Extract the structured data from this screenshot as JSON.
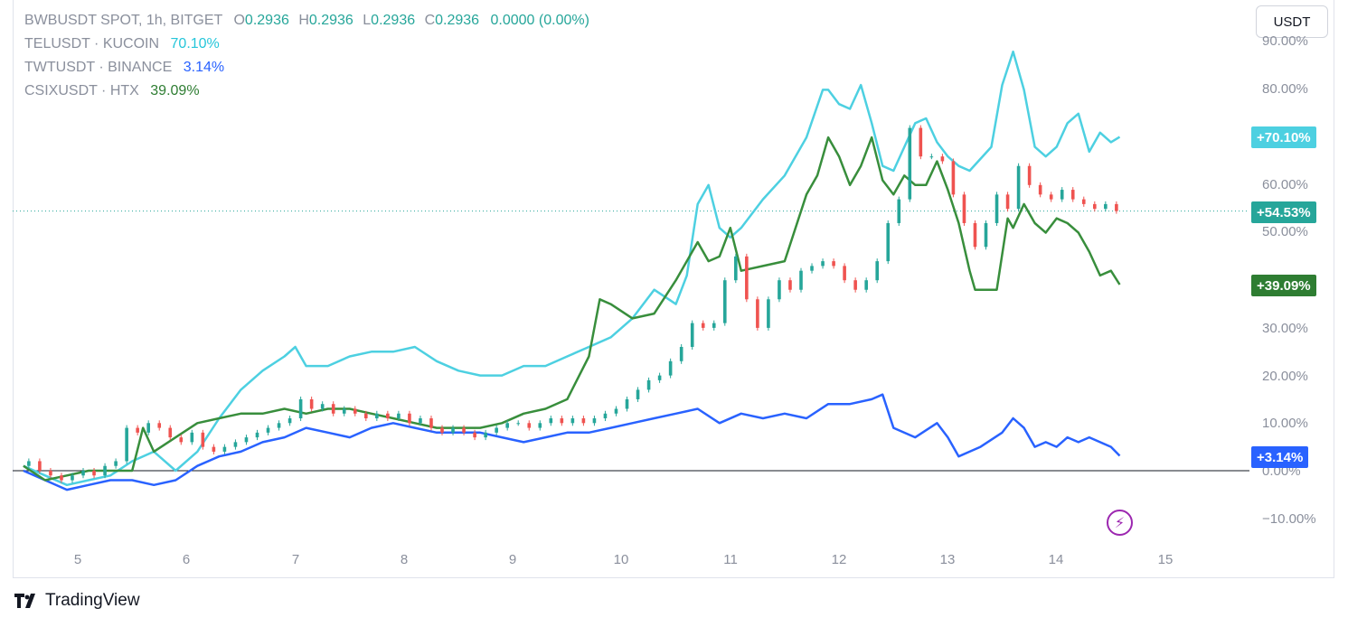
{
  "legend": {
    "main": {
      "symbol": "BWBUSDT SPOT, 1h, BITGET",
      "o_label": "O",
      "o_value": "0.2936",
      "h_label": "H",
      "h_value": "0.2936",
      "l_label": "L",
      "l_value": "0.2936",
      "c_label": "C",
      "c_value": "0.2936",
      "change": "0.0000 (0.00%)"
    },
    "compare": [
      {
        "symbol": "TELUSDT · KUCOIN",
        "value": "70.10%"
      },
      {
        "symbol": "TWTUSDT · BINANCE",
        "value": "3.14%"
      },
      {
        "symbol": "CSIXUSDT · HTX",
        "value": "39.09%"
      }
    ]
  },
  "unit_button": "USDT",
  "colors": {
    "tel": "#4dd0e1",
    "twt": "#2962ff",
    "csix": "#388e3c",
    "up": "#26a69a",
    "down": "#ef5350",
    "badge_main": "#26a69a",
    "badge_tel": "#4dd0e1",
    "badge_csix": "#2e7d32",
    "badge_twt": "#2962ff"
  },
  "badges": {
    "tel": "+70.10%",
    "main": "+54.53%",
    "csix": "+39.09%",
    "twt": "+3.14%"
  },
  "brand": "TradingView",
  "icons": {
    "alert": "lightning-icon",
    "logo": "tradingview-logo-icon"
  },
  "chart_data": {
    "type": "line",
    "ylabel_unit": "%",
    "ylim": [
      -15,
      95
    ],
    "y_ticks": [
      "90.00%",
      "80.00%",
      "60.00%",
      "50.00%",
      "30.00%",
      "20.00%",
      "10.00%",
      "0.00%",
      "−10.00%"
    ],
    "x_ticks": [
      "5",
      "6",
      "7",
      "8",
      "9",
      "10",
      "11",
      "12",
      "13",
      "14",
      "15"
    ],
    "series": [
      {
        "name": "TELUSDT · KUCOIN",
        "key": "tel",
        "x": [
          4.5,
          4.7,
          4.9,
          5.1,
          5.3,
          5.5,
          5.7,
          5.9,
          6.1,
          6.3,
          6.5,
          6.7,
          6.9,
          7.0,
          7.1,
          7.3,
          7.5,
          7.7,
          7.9,
          8.1,
          8.3,
          8.5,
          8.7,
          8.9,
          9.1,
          9.3,
          9.5,
          9.7,
          9.9,
          10.1,
          10.3,
          10.5,
          10.6,
          10.7,
          10.8,
          10.9,
          11.0,
          11.1,
          11.3,
          11.5,
          11.7,
          11.85,
          11.9,
          12.0,
          12.1,
          12.2,
          12.3,
          12.4,
          12.5,
          12.6,
          12.7,
          12.8,
          12.9,
          13.0,
          13.1,
          13.2,
          13.4,
          13.5,
          13.6,
          13.7,
          13.8,
          13.9,
          14.0,
          14.1,
          14.2,
          14.3,
          14.4,
          14.5,
          14.58
        ],
        "y": [
          1,
          -1,
          -3,
          -2,
          -1,
          2,
          4,
          0,
          4,
          11,
          17,
          21,
          24,
          26,
          22,
          22,
          24,
          25,
          25,
          26,
          23,
          21,
          20,
          20,
          22,
          22,
          24,
          26,
          28,
          32,
          38,
          35,
          41,
          56,
          60,
          51,
          49,
          51,
          57,
          62,
          70,
          80,
          80,
          77,
          76,
          81,
          73,
          64,
          63,
          68,
          73,
          74,
          69,
          66,
          64,
          63,
          68,
          81,
          88,
          80,
          68,
          66,
          68,
          73,
          75,
          67,
          71,
          69,
          70.1
        ]
      },
      {
        "name": "TWTUSDT · BINANCE",
        "key": "twt",
        "x": [
          4.5,
          4.7,
          4.9,
          5.1,
          5.3,
          5.5,
          5.7,
          5.9,
          6.1,
          6.3,
          6.5,
          6.7,
          6.9,
          7.1,
          7.3,
          7.5,
          7.7,
          7.9,
          8.1,
          8.3,
          8.5,
          8.7,
          8.9,
          9.1,
          9.3,
          9.5,
          9.7,
          9.9,
          10.1,
          10.3,
          10.5,
          10.7,
          10.9,
          11.1,
          11.3,
          11.5,
          11.7,
          11.9,
          12.1,
          12.3,
          12.4,
          12.5,
          12.7,
          12.9,
          13.0,
          13.1,
          13.2,
          13.3,
          13.5,
          13.6,
          13.7,
          13.8,
          13.9,
          14.0,
          14.1,
          14.2,
          14.3,
          14.4,
          14.5,
          14.58
        ],
        "y": [
          0,
          -2,
          -4,
          -3,
          -2,
          -2,
          -3,
          -2,
          1,
          3,
          4,
          6,
          7,
          9,
          8,
          7,
          9,
          10,
          9,
          8,
          8,
          8,
          7,
          6,
          7,
          8,
          8,
          9,
          10,
          11,
          12,
          13,
          10,
          12,
          11,
          12,
          11,
          14,
          14,
          15,
          16,
          9,
          7,
          10,
          7,
          3,
          4,
          5,
          8,
          11,
          9,
          5,
          6,
          5,
          7,
          6,
          7,
          6,
          5,
          3.14
        ]
      },
      {
        "name": "CSIXUSDT · HTX",
        "key": "csix",
        "x": [
          4.5,
          4.7,
          4.9,
          5.1,
          5.3,
          5.5,
          5.6,
          5.7,
          5.9,
          6.1,
          6.3,
          6.5,
          6.7,
          6.9,
          7.1,
          7.3,
          7.5,
          7.7,
          7.9,
          8.1,
          8.3,
          8.5,
          8.7,
          8.9,
          9.1,
          9.3,
          9.5,
          9.7,
          9.8,
          9.9,
          10.1,
          10.3,
          10.5,
          10.7,
          10.8,
          10.9,
          11.0,
          11.1,
          11.3,
          11.5,
          11.7,
          11.8,
          11.9,
          12.0,
          12.1,
          12.2,
          12.3,
          12.4,
          12.5,
          12.6,
          12.7,
          12.8,
          12.9,
          13.0,
          13.1,
          13.2,
          13.25,
          13.3,
          13.45,
          13.55,
          13.6,
          13.7,
          13.8,
          13.9,
          14.0,
          14.1,
          14.2,
          14.3,
          14.4,
          14.5,
          14.58
        ],
        "y": [
          1,
          -2,
          -1,
          0,
          0,
          0,
          9,
          4,
          7,
          10,
          11,
          12,
          12,
          13,
          12,
          13,
          13,
          12,
          11,
          10,
          9,
          9,
          9,
          10,
          12,
          13,
          15,
          24,
          36,
          35,
          32,
          33,
          40,
          48,
          44,
          45,
          51,
          42,
          43,
          44,
          58,
          62,
          70,
          66,
          60,
          64,
          70,
          61,
          58,
          62,
          60,
          60,
          65,
          59,
          52,
          42,
          38,
          38,
          38,
          53,
          51,
          56,
          52,
          50,
          53,
          52,
          50,
          46,
          41,
          42,
          39.09
        ]
      }
    ],
    "candles": [
      {
        "x": 4.55,
        "o": 1,
        "c": 2
      },
      {
        "x": 4.65,
        "o": 2,
        "c": 0
      },
      {
        "x": 4.75,
        "o": 0,
        "c": -1
      },
      {
        "x": 4.85,
        "o": -1,
        "c": -2
      },
      {
        "x": 4.95,
        "o": -2,
        "c": -1
      },
      {
        "x": 5.05,
        "o": -1,
        "c": 0
      },
      {
        "x": 5.15,
        "o": 0,
        "c": -1
      },
      {
        "x": 5.25,
        "o": -1,
        "c": 1
      },
      {
        "x": 5.35,
        "o": 1,
        "c": 2
      },
      {
        "x": 5.45,
        "o": 2,
        "c": 9
      },
      {
        "x": 5.55,
        "o": 9,
        "c": 8
      },
      {
        "x": 5.65,
        "o": 8,
        "c": 10
      },
      {
        "x": 5.75,
        "o": 10,
        "c": 9
      },
      {
        "x": 5.85,
        "o": 9,
        "c": 7
      },
      {
        "x": 5.95,
        "o": 7,
        "c": 6
      },
      {
        "x": 6.05,
        "o": 6,
        "c": 8
      },
      {
        "x": 6.15,
        "o": 8,
        "c": 5
      },
      {
        "x": 6.25,
        "o": 5,
        "c": 4
      },
      {
        "x": 6.35,
        "o": 4,
        "c": 5
      },
      {
        "x": 6.45,
        "o": 5,
        "c": 6
      },
      {
        "x": 6.55,
        "o": 6,
        "c": 7
      },
      {
        "x": 6.65,
        "o": 7,
        "c": 8
      },
      {
        "x": 6.75,
        "o": 8,
        "c": 9
      },
      {
        "x": 6.85,
        "o": 9,
        "c": 10
      },
      {
        "x": 6.95,
        "o": 10,
        "c": 11
      },
      {
        "x": 7.05,
        "o": 11,
        "c": 15
      },
      {
        "x": 7.15,
        "o": 15,
        "c": 13
      },
      {
        "x": 7.25,
        "o": 13,
        "c": 14
      },
      {
        "x": 7.35,
        "o": 14,
        "c": 12
      },
      {
        "x": 7.45,
        "o": 12,
        "c": 13
      },
      {
        "x": 7.55,
        "o": 13,
        "c": 12
      },
      {
        "x": 7.65,
        "o": 12,
        "c": 11
      },
      {
        "x": 7.75,
        "o": 11,
        "c": 12
      },
      {
        "x": 7.85,
        "o": 12,
        "c": 11
      },
      {
        "x": 7.95,
        "o": 11,
        "c": 12
      },
      {
        "x": 8.05,
        "o": 12,
        "c": 10
      },
      {
        "x": 8.15,
        "o": 10,
        "c": 11
      },
      {
        "x": 8.25,
        "o": 11,
        "c": 9
      },
      {
        "x": 8.35,
        "o": 9,
        "c": 8
      },
      {
        "x": 8.45,
        "o": 8,
        "c": 9
      },
      {
        "x": 8.55,
        "o": 9,
        "c": 8
      },
      {
        "x": 8.65,
        "o": 8,
        "c": 7
      },
      {
        "x": 8.75,
        "o": 7,
        "c": 8
      },
      {
        "x": 8.85,
        "o": 8,
        "c": 9
      },
      {
        "x": 8.95,
        "o": 9,
        "c": 10
      },
      {
        "x": 9.05,
        "o": 10,
        "c": 10
      },
      {
        "x": 9.15,
        "o": 10,
        "c": 9
      },
      {
        "x": 9.25,
        "o": 9,
        "c": 10
      },
      {
        "x": 9.35,
        "o": 10,
        "c": 11
      },
      {
        "x": 9.45,
        "o": 11,
        "c": 10
      },
      {
        "x": 9.55,
        "o": 10,
        "c": 11
      },
      {
        "x": 9.65,
        "o": 11,
        "c": 10
      },
      {
        "x": 9.75,
        "o": 10,
        "c": 11
      },
      {
        "x": 9.85,
        "o": 11,
        "c": 12
      },
      {
        "x": 9.95,
        "o": 12,
        "c": 13
      },
      {
        "x": 10.05,
        "o": 13,
        "c": 15
      },
      {
        "x": 10.15,
        "o": 15,
        "c": 17
      },
      {
        "x": 10.25,
        "o": 17,
        "c": 19
      },
      {
        "x": 10.35,
        "o": 19,
        "c": 20
      },
      {
        "x": 10.45,
        "o": 20,
        "c": 23
      },
      {
        "x": 10.55,
        "o": 23,
        "c": 26
      },
      {
        "x": 10.65,
        "o": 26,
        "c": 31
      },
      {
        "x": 10.75,
        "o": 31,
        "c": 30
      },
      {
        "x": 10.85,
        "o": 30,
        "c": 31
      },
      {
        "x": 10.95,
        "o": 31,
        "c": 40
      },
      {
        "x": 11.05,
        "o": 40,
        "c": 45
      },
      {
        "x": 11.15,
        "o": 45,
        "c": 36
      },
      {
        "x": 11.25,
        "o": 36,
        "c": 30
      },
      {
        "x": 11.35,
        "o": 30,
        "c": 36
      },
      {
        "x": 11.45,
        "o": 36,
        "c": 40
      },
      {
        "x": 11.55,
        "o": 40,
        "c": 38
      },
      {
        "x": 11.65,
        "o": 38,
        "c": 42
      },
      {
        "x": 11.75,
        "o": 42,
        "c": 43
      },
      {
        "x": 11.85,
        "o": 43,
        "c": 44
      },
      {
        "x": 11.95,
        "o": 44,
        "c": 43
      },
      {
        "x": 12.05,
        "o": 43,
        "c": 40
      },
      {
        "x": 12.15,
        "o": 40,
        "c": 38
      },
      {
        "x": 12.25,
        "o": 38,
        "c": 40
      },
      {
        "x": 12.35,
        "o": 40,
        "c": 44
      },
      {
        "x": 12.45,
        "o": 44,
        "c": 52
      },
      {
        "x": 12.55,
        "o": 52,
        "c": 57
      },
      {
        "x": 12.65,
        "o": 57,
        "c": 72
      },
      {
        "x": 12.75,
        "o": 72,
        "c": 66
      },
      {
        "x": 12.85,
        "o": 66,
        "c": 66
      },
      {
        "x": 12.95,
        "o": 66,
        "c": 65
      },
      {
        "x": 13.05,
        "o": 65,
        "c": 58
      },
      {
        "x": 13.15,
        "o": 58,
        "c": 52
      },
      {
        "x": 13.25,
        "o": 52,
        "c": 47
      },
      {
        "x": 13.35,
        "o": 47,
        "c": 52
      },
      {
        "x": 13.45,
        "o": 52,
        "c": 58
      },
      {
        "x": 13.55,
        "o": 58,
        "c": 55
      },
      {
        "x": 13.65,
        "o": 55,
        "c": 64
      },
      {
        "x": 13.75,
        "o": 64,
        "c": 60
      },
      {
        "x": 13.85,
        "o": 60,
        "c": 58
      },
      {
        "x": 13.95,
        "o": 58,
        "c": 57
      },
      {
        "x": 14.05,
        "o": 57,
        "c": 59
      },
      {
        "x": 14.15,
        "o": 59,
        "c": 57
      },
      {
        "x": 14.25,
        "o": 57,
        "c": 56
      },
      {
        "x": 14.35,
        "o": 56,
        "c": 55
      },
      {
        "x": 14.45,
        "o": 55,
        "c": 56
      },
      {
        "x": 14.55,
        "o": 56,
        "c": 54.53
      }
    ]
  }
}
